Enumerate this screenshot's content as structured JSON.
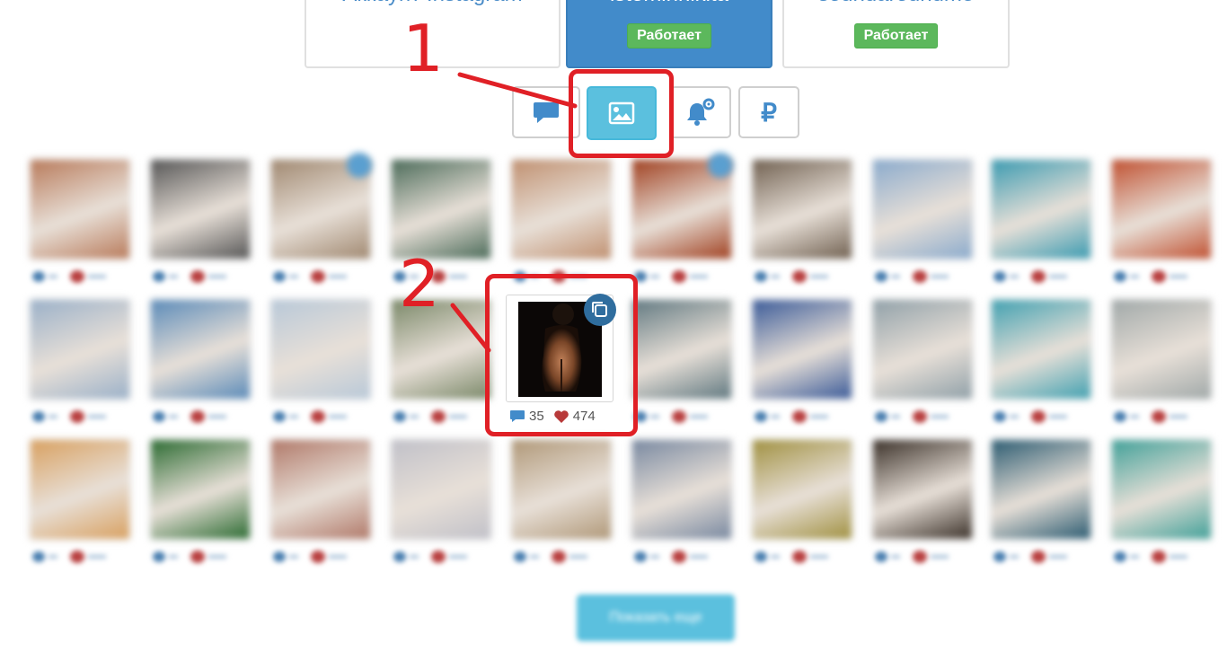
{
  "accounts": [
    {
      "name": "Аккаунт Instagram",
      "status": ""
    },
    {
      "name": "istominnikita",
      "status": "Работает"
    },
    {
      "name": "soundaroundme",
      "status": "Работает"
    }
  ],
  "tabs": [
    {
      "icon": "comment-icon"
    },
    {
      "icon": "image-icon"
    },
    {
      "icon": "bell-gear-icon"
    },
    {
      "icon": "ruble-icon",
      "symbol": "₽"
    }
  ],
  "annotations": {
    "step1": "1",
    "step2": "2"
  },
  "grid": {
    "thumb_colors": [
      [
        "#b87a5a",
        "#555555",
        "#a08870",
        "#4a6a58",
        "#c09070",
        "#a04020",
        "#706050",
        "#8aaacc",
        "#3a9ab0",
        "#c05030"
      ],
      [
        "#9ab0c8",
        "#5a8ab8",
        "#b8c8d8",
        "#7a8868",
        "#ffffff",
        "#607880",
        "#3a5a98",
        "#90a0a8",
        "#40a0b0",
        "#a0a8a8"
      ],
      [
        "#d8a060",
        "#2a6a30",
        "#b07868",
        "#c0c0c8",
        "#b09878",
        "#7888a0",
        "#a09040",
        "#3a3028",
        "#2a5a70",
        "#40a098"
      ]
    ]
  },
  "focused_item": {
    "comments": "35",
    "likes": "474",
    "icon": "copy-multiple-icon"
  },
  "load_more": {
    "label": "Показать еще"
  },
  "colors": {
    "accent": "#428bca",
    "success": "#5cb85c",
    "annotation": "#e02026",
    "tab_active": "#5bc0de"
  }
}
